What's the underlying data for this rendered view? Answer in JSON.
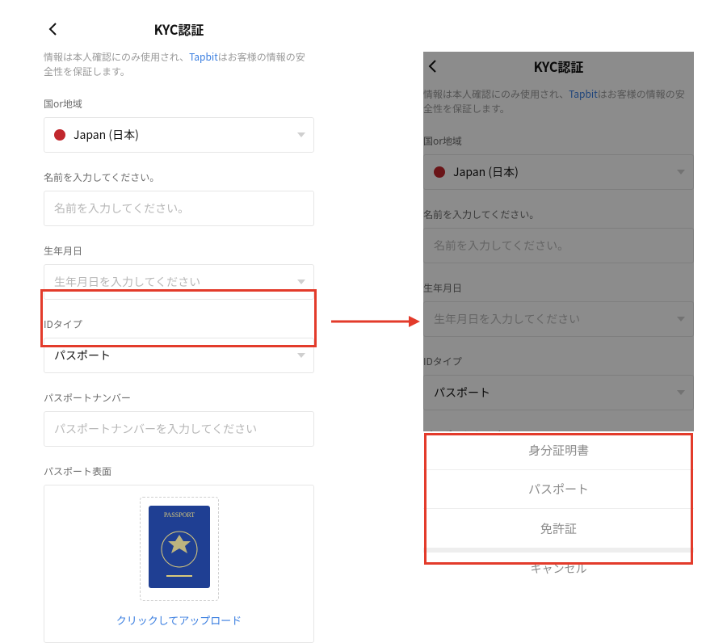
{
  "header": {
    "title": "KYC認証"
  },
  "desc": {
    "before": "情報は本人確認にのみ使用され、",
    "brand": "Tapbit",
    "after": "はお客様の情報の安全性を保証します。"
  },
  "fields": {
    "country_label": "国or地域",
    "country_value": "Japan (日本)",
    "name_label": "名前を入力してください。",
    "name_placeholder": "名前を入力してください。",
    "dob_label": "生年月日",
    "dob_placeholder": "生年月日を入力してください",
    "idtype_label": "IDタイプ",
    "idtype_value": "パスポート",
    "passport_num_label": "パスポートナンバー",
    "passport_num_placeholder": "パスポートナンバーを入力してください",
    "passport_front_label": "パスポート表面",
    "upload_cta": "クリックしてアップロード",
    "passport_word": "PASSPORT"
  },
  "sheet": {
    "options": [
      "身分証明書",
      "パスポート",
      "免許証"
    ],
    "cancel": "キャンセル"
  },
  "colors": {
    "annotation": "#e33b2b",
    "link": "#3a7ee0",
    "flag": "#c1272d"
  }
}
